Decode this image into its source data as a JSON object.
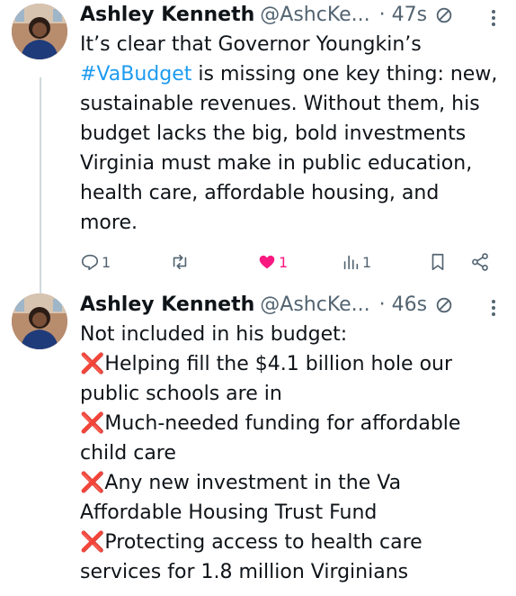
{
  "colors": {
    "text": "#0f1419",
    "secondary": "#536471",
    "hashtag": "#1d9bf0",
    "like": "#f91880",
    "cross": "#e03a3a"
  },
  "tweets": [
    {
      "author_name": "Ashley Kenneth",
      "author_handle": "@AshcKe...",
      "time": "· 47s",
      "text_before": "It’s clear that Governor Youngkin’s ",
      "hashtag": "#VaBudget",
      "text_after": " is missing one key thing: new, sustainable revenues. Without them, his budget lacks the big, bold investments Virginia must make in public education, health care, affordable housing, and more.",
      "actions": {
        "reply_count": "1",
        "retweet_count": "",
        "like_count": "1",
        "views_count": "1"
      },
      "icons": [
        "reply-icon",
        "retweet-icon",
        "heart-filled-icon",
        "views-icon",
        "bookmark-icon",
        "share-icon"
      ]
    },
    {
      "author_name": "Ashley Kenneth",
      "author_handle": "@AshcKe...",
      "time": "· 46s",
      "intro": "Not included in his budget:",
      "items": [
        "Helping fill the $4.1 billion hole our public schools are in",
        "Much-needed funding for affordable child care",
        "Any new investment in the Va Affordable Housing Trust Fund",
        "Protecting access to health care services for 1.8 million Virginians"
      ],
      "item_marker": "❌"
    }
  ]
}
